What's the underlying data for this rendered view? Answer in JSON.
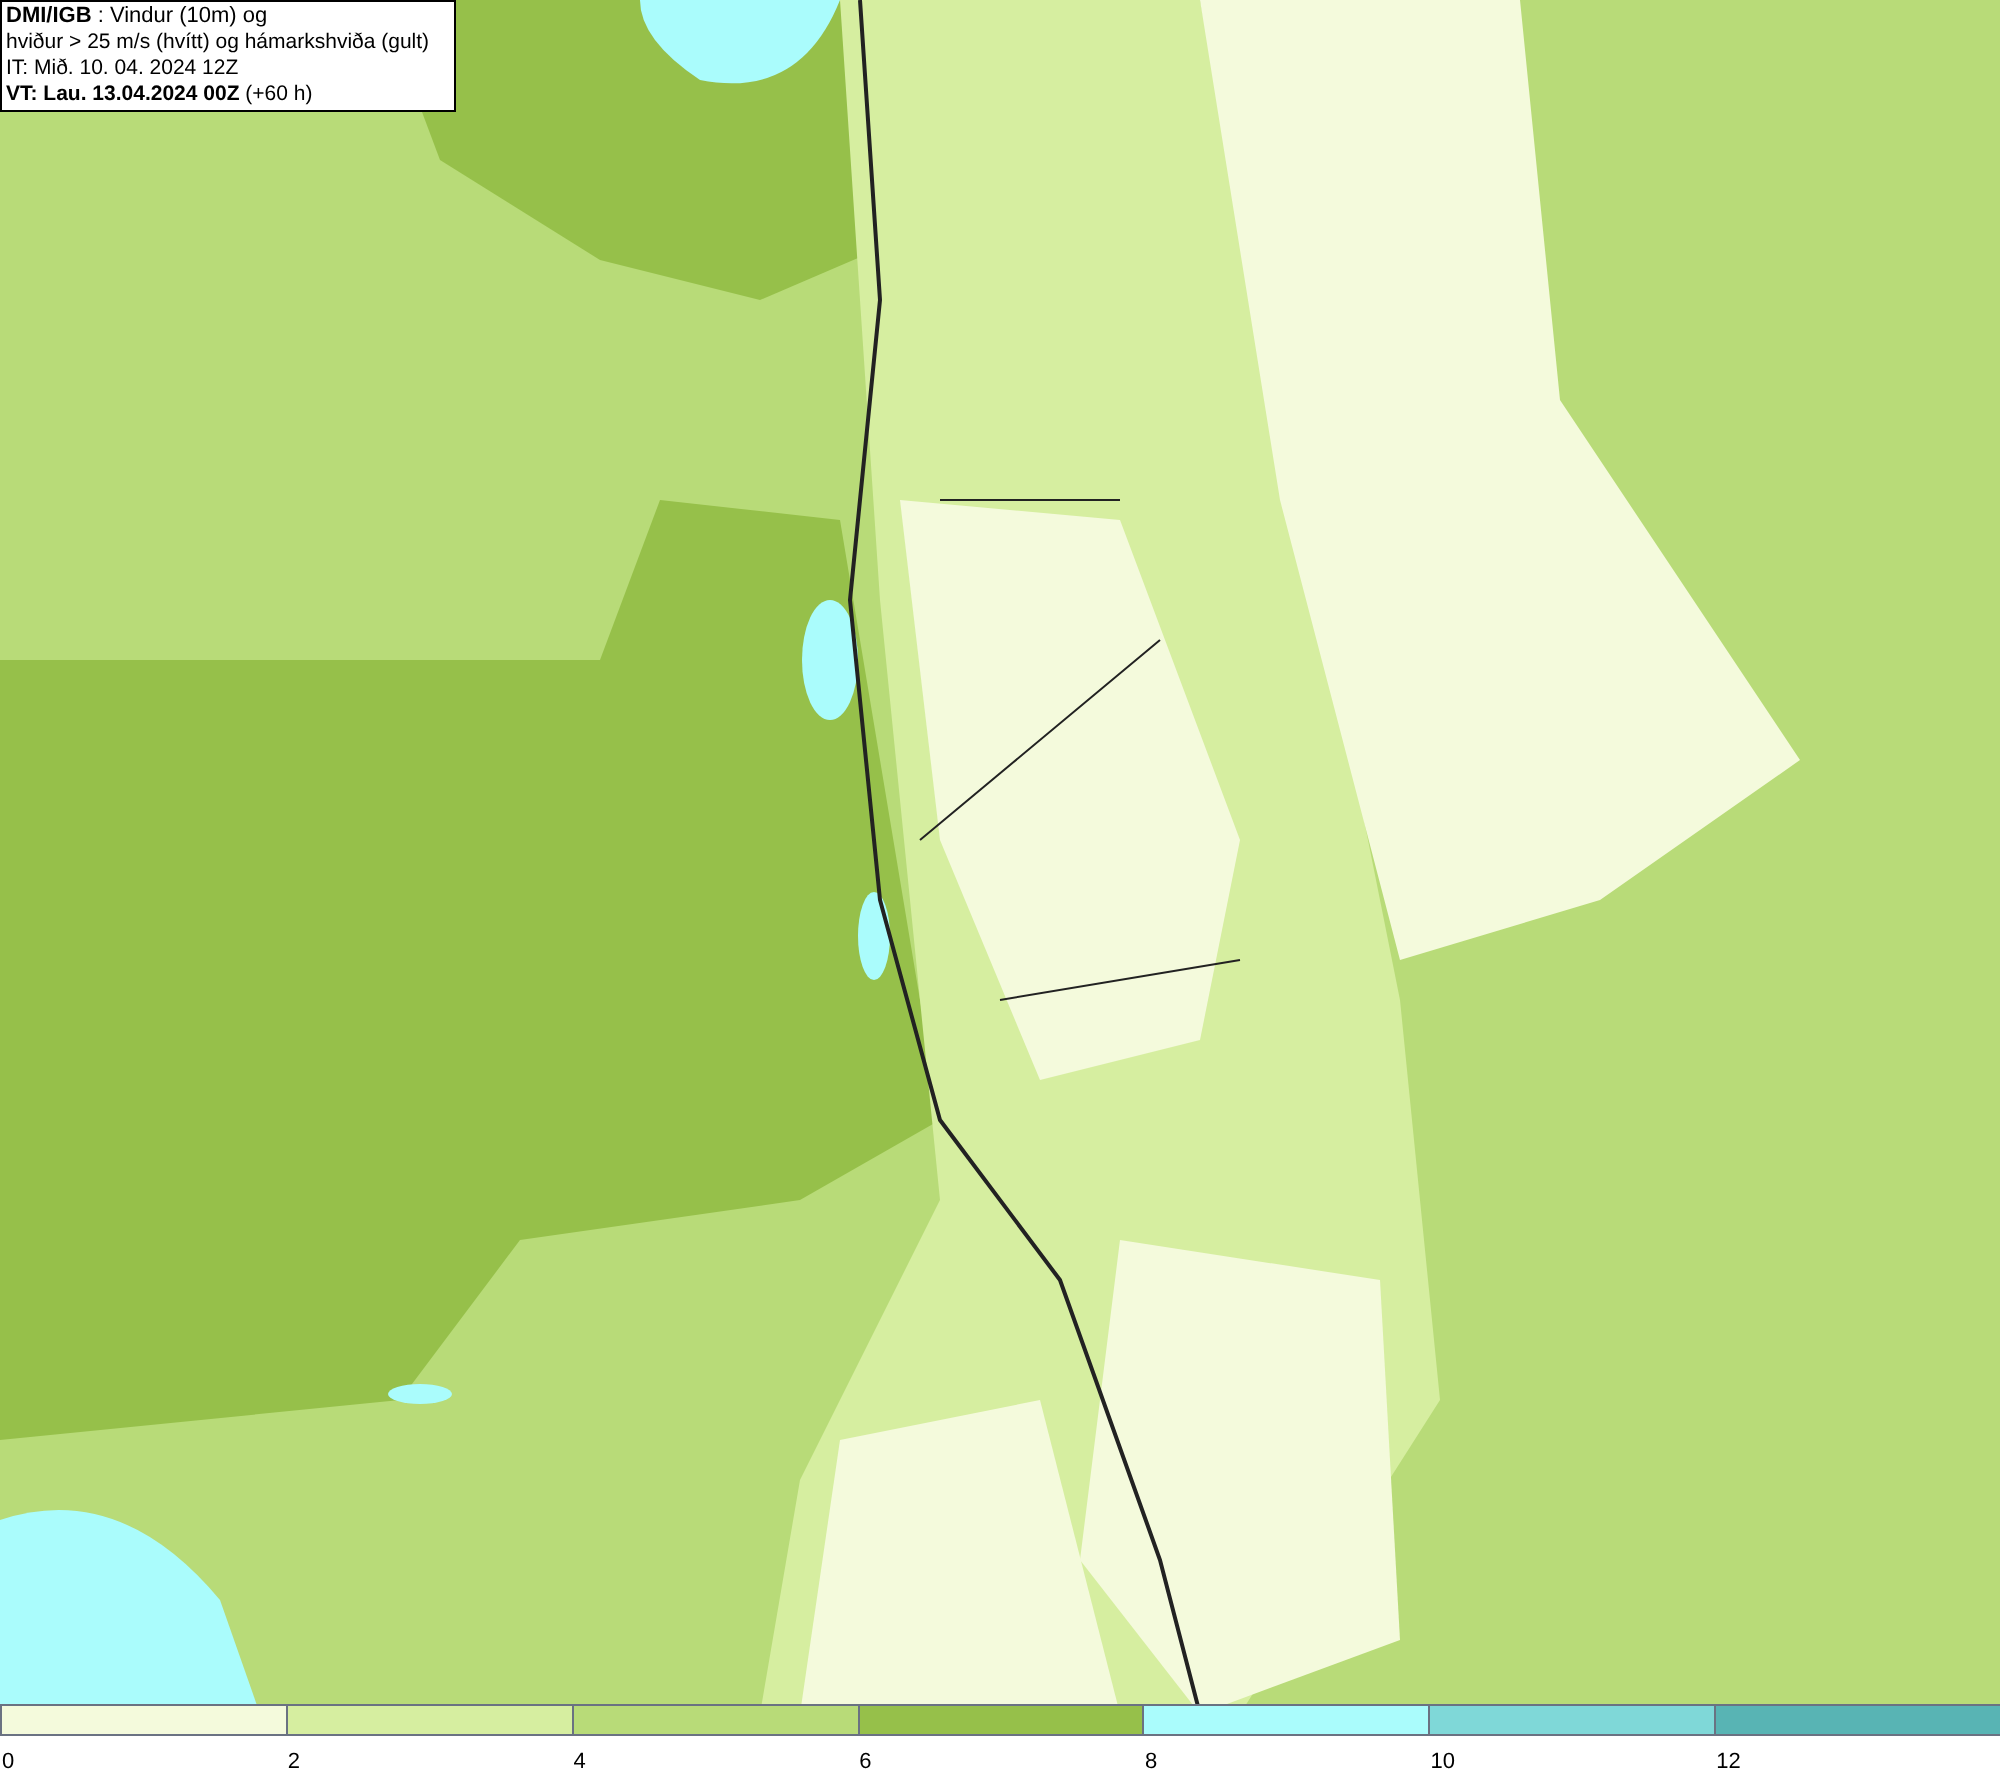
{
  "title_box": {
    "lines": [
      "**DMI/IGB** : Vindur (10m) og",
      "hviður > 25 m/s (hvítt) og hámarkshviða (gult)",
      "IT: Mið. 10. 04. 2024 12Z",
      "**VT: Lau. 13.04.2024 00Z** (+60 h)"
    ]
  },
  "legend": {
    "segments": [
      {
        "color": "#f4fadc",
        "label": "0"
      },
      {
        "color": "#d6eea0",
        "label": "2"
      },
      {
        "color": "#b8db78",
        "label": "4"
      },
      {
        "color": "#96c04a",
        "label": "6"
      },
      {
        "color": "#aafcfc",
        "label": "8"
      },
      {
        "color": "#7fd8d8",
        "label": "10"
      },
      {
        "color": "#58b4b4",
        "label": "12"
      }
    ]
  }
}
